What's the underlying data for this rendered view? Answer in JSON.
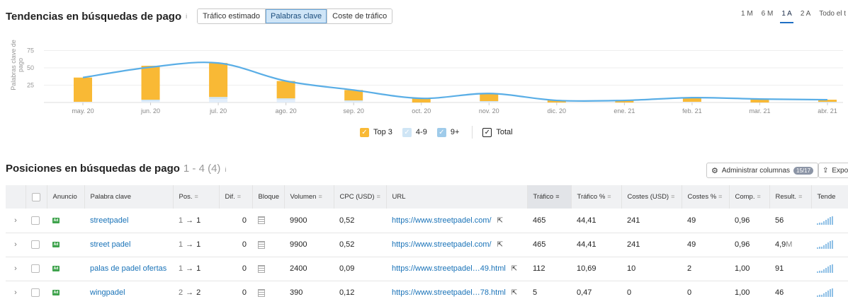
{
  "trends": {
    "title": "Tendencias en búsquedas de pago",
    "info": "i",
    "tabs": [
      "Tráfico estimado",
      "Palabras clave",
      "Coste de tráfico"
    ],
    "active_tab": 1,
    "periods": [
      "1 M",
      "6 M",
      "1 A",
      "2 A",
      "Todo el t"
    ],
    "active_period": 2
  },
  "colors": {
    "top3": "#f9b935",
    "range_4_9": "#cfe5f5",
    "range_9plus": "#e3eefa",
    "line": "#5aaee6",
    "link": "#1a73b8",
    "ad_green": "#3fa34d"
  },
  "chart_data": {
    "type": "bar",
    "ylabel": "Palabras clave de pago",
    "yticks": [
      25,
      50,
      75
    ],
    "ylim": [
      0,
      80
    ],
    "categories": [
      "may. 20",
      "jun. 20",
      "jul. 20",
      "ago. 20",
      "sep. 20",
      "oct. 20",
      "nov. 20",
      "dic. 20",
      "ene. 21",
      "feb. 21",
      "mar. 21",
      "abr. 21"
    ],
    "series": [
      {
        "name": "Top 3",
        "values": [
          35,
          49,
          49,
          25,
          15,
          6,
          11,
          3,
          3,
          6,
          5,
          3
        ]
      },
      {
        "name": "4-9",
        "values": [
          0,
          2,
          3,
          2,
          1,
          0,
          1,
          0,
          0,
          0,
          0,
          1
        ]
      },
      {
        "name": "9+",
        "values": [
          1,
          2,
          5,
          4,
          2,
          0,
          1,
          0,
          0,
          1,
          0,
          0
        ]
      },
      {
        "name": "Total",
        "values": [
          36,
          51,
          57,
          31,
          18,
          6,
          13,
          3,
          3,
          7,
          5,
          4
        ]
      }
    ],
    "legend_position": "bottom-center",
    "grid": true
  },
  "legend": [
    {
      "label": "Top 3",
      "color": "#f9b935",
      "checked": true
    },
    {
      "label": "4-9",
      "color": "#cfe5f5",
      "checked": true
    },
    {
      "label": "9+",
      "color": "#9fcbea",
      "checked": true
    },
    {
      "label": "Total",
      "color": "#222222",
      "checked": true,
      "outlined": true
    }
  ],
  "positions": {
    "title": "Posiciones en búsquedas de pago",
    "range": "1 - 4 (4)",
    "info": "i",
    "manage_columns": "Administrar columnas",
    "manage_columns_badge": "15/17",
    "export": "Expo"
  },
  "table": {
    "headers": [
      "",
      "",
      "Anuncio",
      "Palabra clave",
      "Pos.",
      "Dif.",
      "Bloque",
      "Volumen",
      "CPC (USD)",
      "URL",
      "Tráfico",
      "Tráfico %",
      "Costes (USD)",
      "Costes %",
      "Comp.",
      "Result.",
      "Tende"
    ],
    "rows": [
      {
        "keyword": "streetpadel",
        "pos_from": "1",
        "pos_to": "1",
        "dif": "0",
        "volume": "9900",
        "cpc": "0,52",
        "url": "https://www.streetpadel.com/",
        "traffic": "465",
        "traffic_pct": "44,41",
        "costs": "241",
        "costs_pct": "49",
        "comp": "0,96",
        "results": "56",
        "results_unit": ""
      },
      {
        "keyword": "street padel",
        "pos_from": "1",
        "pos_to": "1",
        "dif": "0",
        "volume": "9900",
        "cpc": "0,52",
        "url": "https://www.streetpadel.com/",
        "traffic": "465",
        "traffic_pct": "44,41",
        "costs": "241",
        "costs_pct": "49",
        "comp": "0,96",
        "results": "4,9",
        "results_unit": "M"
      },
      {
        "keyword": "palas de padel ofertas",
        "pos_from": "1",
        "pos_to": "1",
        "dif": "0",
        "volume": "2400",
        "cpc": "0,09",
        "url": "https://www.streetpadel…49.html",
        "traffic": "112",
        "traffic_pct": "10,69",
        "costs": "10",
        "costs_pct": "2",
        "comp": "1,00",
        "results": "91",
        "results_unit": ""
      },
      {
        "keyword": "wingpadel",
        "pos_from": "2",
        "pos_to": "2",
        "dif": "0",
        "volume": "390",
        "cpc": "0,12",
        "url": "https://www.streetpadel…78.html",
        "traffic": "5",
        "traffic_pct": "0,47",
        "costs": "0",
        "costs_pct": "0",
        "comp": "1,00",
        "results": "46",
        "results_unit": ""
      }
    ]
  }
}
